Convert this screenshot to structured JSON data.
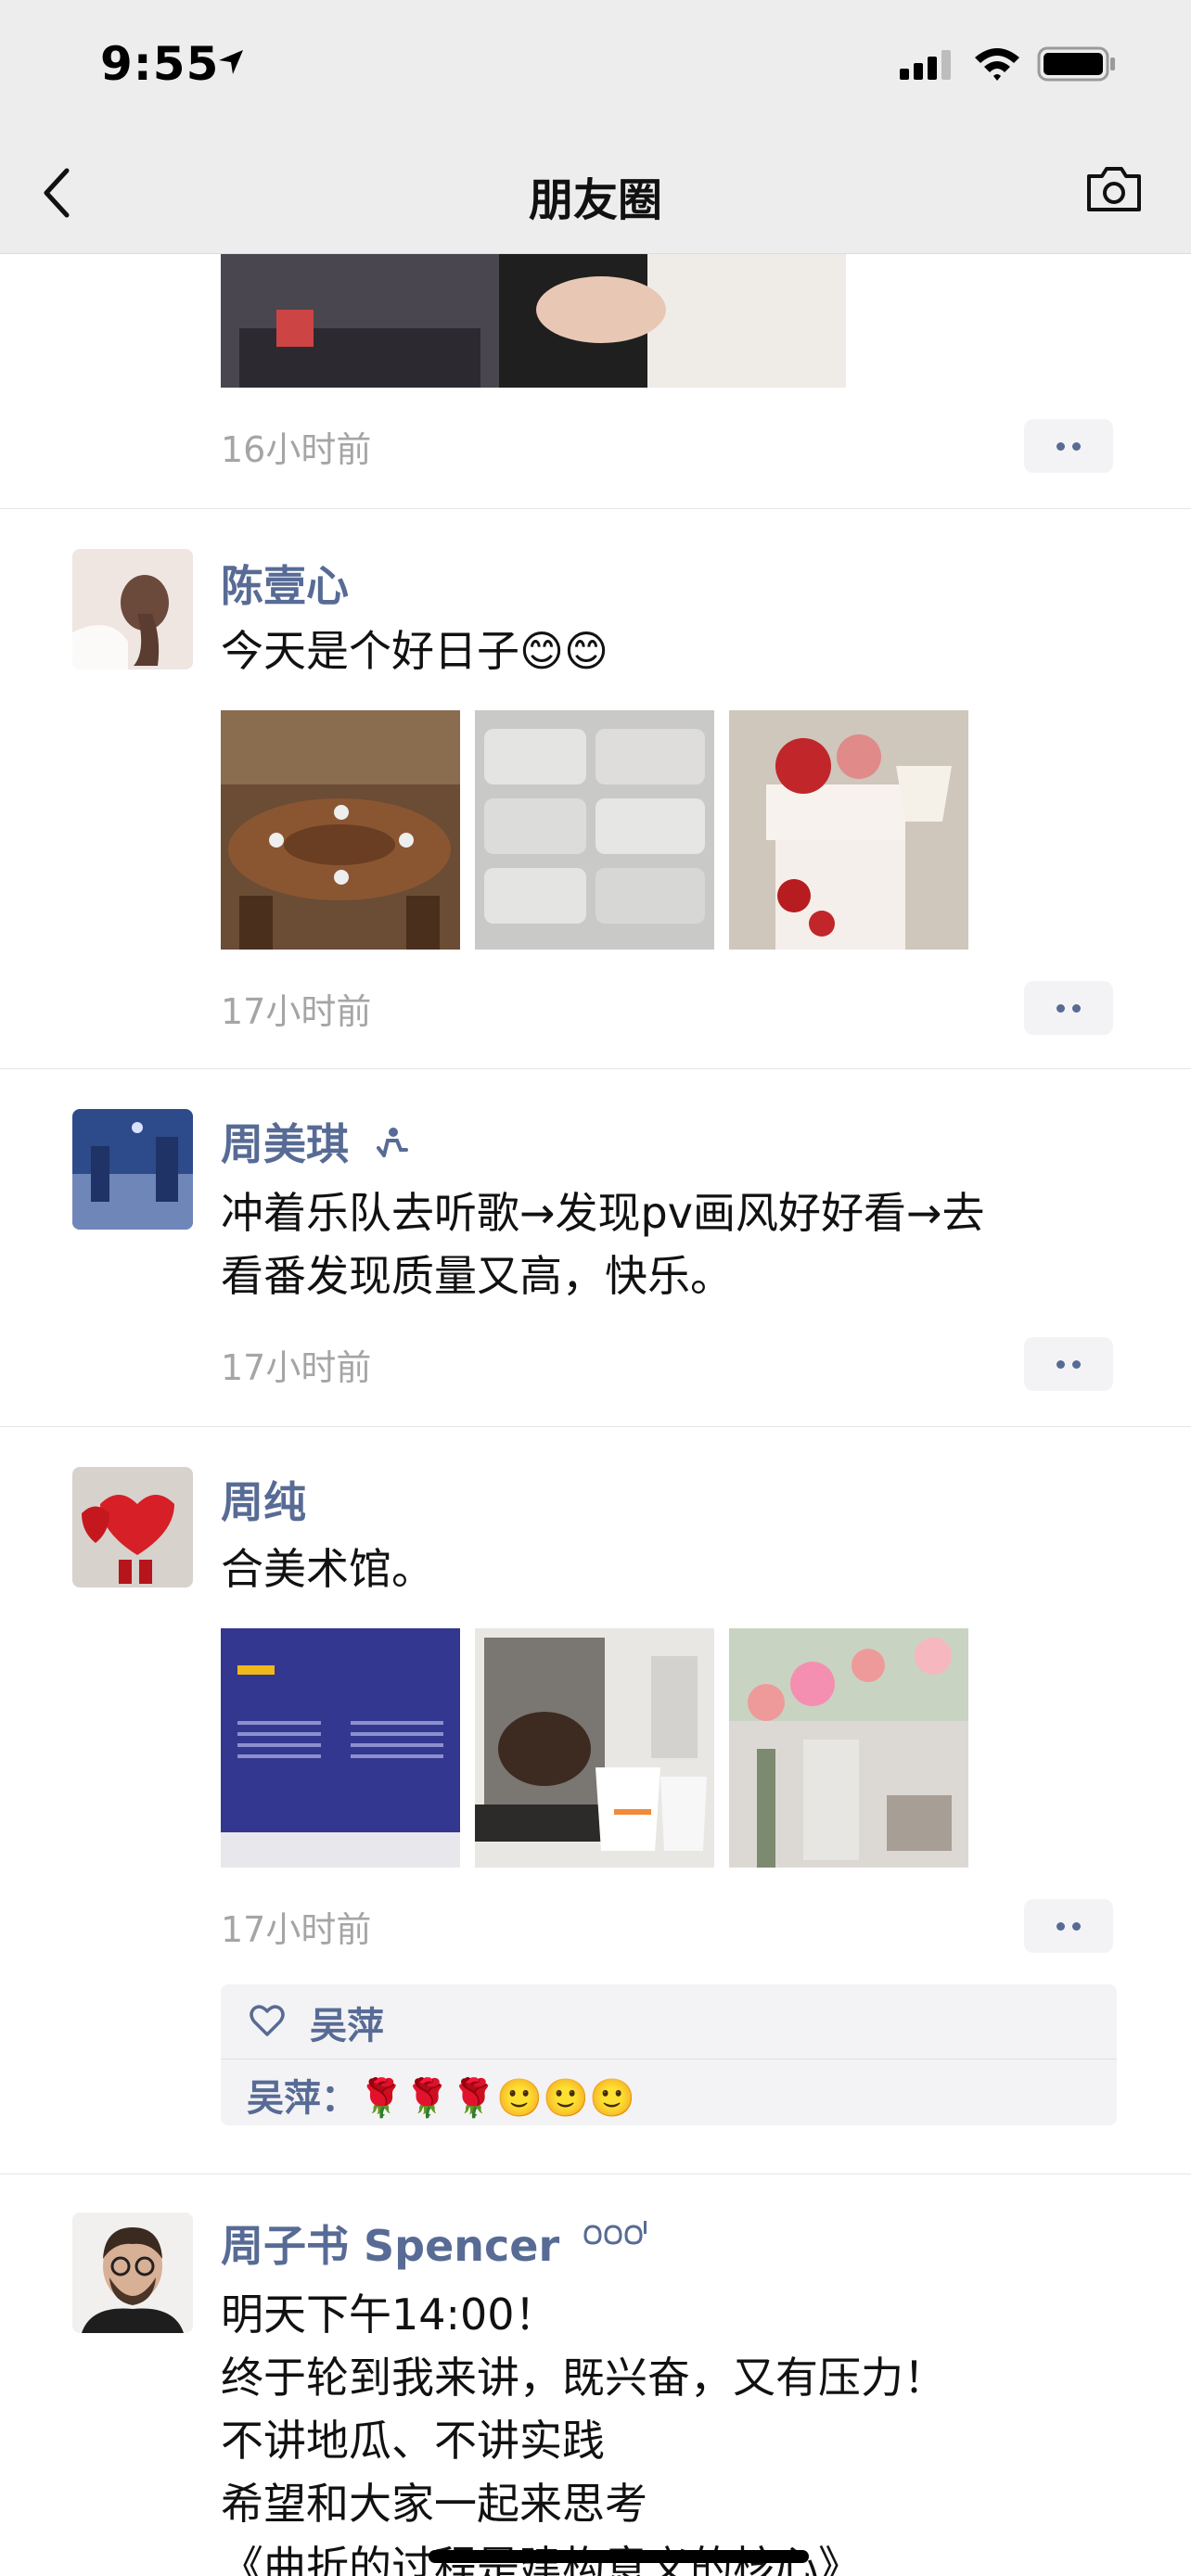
{
  "status_bar": {
    "time": "9:55"
  },
  "header": {
    "title": "朋友圈"
  },
  "icons": {
    "back": "chevron-left-icon",
    "camera": "camera-icon",
    "location": "location-arrow-icon",
    "signal": "signal-icon",
    "wifi": "wifi-icon",
    "battery": "battery-icon",
    "like": "heart-icon",
    "more": "more-dots-icon"
  },
  "colors": {
    "link": "#576b95",
    "header_bg": "#ededed",
    "timestamp": "#a5a5a5"
  },
  "posts": [
    {
      "time": "16小时前"
    },
    {
      "name": "陈壹心",
      "text": "今天是个好日子😊😊",
      "time": "17小时前"
    },
    {
      "name": "周美琪",
      "text": "冲着乐队去听歌→发现pv画风好好看→去\n看番发现质量又高，快乐。",
      "time": "17小时前"
    },
    {
      "name": "周纯",
      "text": "合美术馆。",
      "time": "17小时前",
      "likes": [
        "吴萍"
      ],
      "comment": {
        "author": "吴萍：",
        "text": "🌹🌹🌹🙂🙂🙂"
      }
    },
    {
      "name": "周子书 Spencer",
      "text": "明天下午14:00！\n终于轮到我来讲，既兴奋，又有压力！\n不讲地瓜、不讲实践\n希望和大家一起来思考\n《曲折的过程是建构意义的核心》"
    }
  ]
}
